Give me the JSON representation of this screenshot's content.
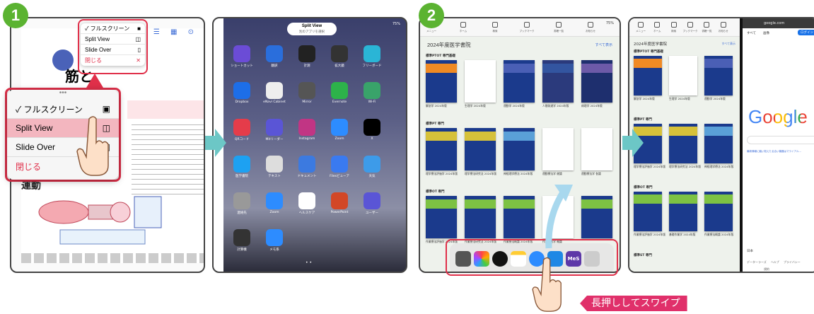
{
  "steps": [
    "1",
    "2"
  ],
  "panel1": {
    "menu_small": {
      "items": [
        {
          "label": "✓ フルスクリーン",
          "icon": "■"
        },
        {
          "label": "Split View",
          "icon": "◫"
        },
        {
          "label": "Slide Over",
          "icon": "▯"
        },
        {
          "label": "閉じる",
          "icon": "✕"
        }
      ]
    },
    "menu_big": {
      "items": [
        {
          "label": "✓ フルスクリーン",
          "icon": "▣"
        },
        {
          "label": "Split View",
          "icon": "◫"
        },
        {
          "label": "Slide Over",
          "icon": "▯"
        },
        {
          "label": "閉じる",
          "icon": ""
        }
      ]
    },
    "page_heading": "筋と",
    "heading_box": "運動"
  },
  "panel2": {
    "pill_title": "Split View",
    "pill_sub": "別のアプリを選択",
    "status_batt": "75%",
    "apps": [
      [
        "ショートカット",
        "翻訳",
        "計測",
        "拡大鏡",
        "フリーボード"
      ],
      [
        "Dropbox",
        "eNavi Cabinet",
        "Mirror",
        "Evernote",
        "Wi-Fi"
      ],
      [
        "QRコード",
        "Mitリーダー",
        "Instagram",
        "Zoom",
        "X"
      ],
      [
        "医学書院",
        "テキスト",
        "ドキュメント",
        "Filesビューア",
        "天気"
      ],
      [
        "連絡先",
        "Zoom",
        "ヘルスケア",
        "PowerPoint",
        "ユーザー"
      ],
      [
        "計算機",
        "メモ系",
        "",
        "",
        ""
      ]
    ],
    "app_colors": [
      [
        "#6b4cd6",
        "#2a6edc",
        "#222",
        "#333",
        "#2ab5d6"
      ],
      [
        "#1d6ee8",
        "#eee",
        "#555",
        "#2db24a",
        "#39a36a"
      ],
      [
        "#e53c4a",
        "#5a55d6",
        "#c13584",
        "#2d8cff",
        "#000"
      ],
      [
        "#1da1f2",
        "#ddd",
        "#3c7ae0",
        "#3a7af0",
        "#3d9be9"
      ],
      [
        "#999",
        "#2d8cff",
        "#fff",
        "#d24726",
        "#5a55d6"
      ],
      [
        "#333",
        "#2d8cff",
        "",
        "",
        ""
      ]
    ]
  },
  "panel3": {
    "status_batt": "75%",
    "toolbar": [
      "メニュー",
      "ホーム",
      "検索",
      "ブックマーク",
      "書籍一覧",
      "お知らせ"
    ],
    "title": "2024年度医学書院",
    "see_all": "すべて表示",
    "sections": [
      {
        "name": "標準PTOT 専門基礎",
        "books": [
          {
            "label": "解剖学 2024年版",
            "color": "#1b3a8c",
            "band": "#f08a24"
          },
          {
            "label": "生理学 2024年版",
            "color": "#ffffff",
            "band": "#ffffff"
          },
          {
            "label": "運動学 2024年版",
            "color": "#1b3a8c",
            "band": "#4a5fb5"
          },
          {
            "label": "人間発達学 2024年版",
            "color": "#2b3a7c",
            "band": "#3355a0"
          },
          {
            "label": "病理学 2024年版",
            "color": "#1e2f6e",
            "band": "#6d5aa8"
          }
        ]
      },
      {
        "name": "標準PT 専門",
        "books": [
          {
            "label": "理学療法評価学 2024年版",
            "color": "#1b3a8c",
            "band": "#d6c13a"
          },
          {
            "label": "理学療法研究法 2024年版",
            "color": "#1b3a8c",
            "band": "#d6c13a"
          },
          {
            "label": "神経理学療法 2024年版",
            "color": "#1b3a8c",
            "band": "#5aa0d8"
          },
          {
            "label": "運動療法学 総論",
            "color": "#ffffff",
            "band": "#ffffff"
          },
          {
            "label": "運動療法学 各論",
            "color": "#ffffff",
            "band": "#ffffff"
          }
        ]
      },
      {
        "name": "標準OT 専門",
        "books": [
          {
            "label": "作業療法評価学 2024年版",
            "color": "#1b3a8c",
            "band": "#7dc243"
          },
          {
            "label": "作業療法研究法 2024年版",
            "color": "#1b3a8c",
            "band": "#7dc243"
          },
          {
            "label": "作業療法概論 2024年版",
            "color": "#1b3a8c",
            "band": "#7dc243"
          },
          {
            "label": "作業療法学 概論",
            "color": "#ffffff",
            "band": "#ffffff"
          },
          {
            "label": "",
            "color": "#1b3a8c",
            "band": "#7dc243"
          }
        ]
      }
    ],
    "dock_badge": "MeS",
    "callout": "長押ししてスワイプ"
  },
  "panel4": {
    "left": {
      "toolbar": [
        "メニュー",
        "ホーム",
        "検索",
        "ブックマーク",
        "書籍一覧",
        "お知らせ"
      ],
      "title": "2024年度医学書院",
      "see_all": "すべて表示",
      "sections": [
        {
          "name": "標準PTOT 専門基礎",
          "books": [
            {
              "label": "解剖学 2024年版",
              "color": "#1b3a8c",
              "band": "#f08a24"
            },
            {
              "label": "生理学 2024年版",
              "color": "#ffffff",
              "band": "#ffffff"
            },
            {
              "label": "運動学 2024年版",
              "color": "#1b3a8c",
              "band": "#4a5fb5"
            }
          ]
        },
        {
          "name": "標準PT 専門",
          "books": [
            {
              "label": "理学療法評価学 2024年版",
              "color": "#1b3a8c",
              "band": "#d6c13a"
            },
            {
              "label": "理学療法研究法 2024年版",
              "color": "#1b3a8c",
              "band": "#d6c13a"
            },
            {
              "label": "神経理学療法 2024年版",
              "color": "#1b3a8c",
              "band": "#5aa0d8"
            }
          ]
        },
        {
          "name": "標準OT 専門",
          "books": [
            {
              "label": "作業療法評価学 2024年版",
              "color": "#1b3a8c",
              "band": "#7dc243"
            },
            {
              "label": "基礎作業学 2024年版",
              "color": "#1b3a8c",
              "band": "#7dc243"
            },
            {
              "label": "作業療法概論 2024年版",
              "color": "#1b3a8c",
              "band": "#7dc243"
            }
          ]
        },
        {
          "name": "標準ST 専門",
          "books": []
        }
      ]
    },
    "right": {
      "url": "google.com",
      "tabs": [
        "すべて",
        "画像",
        "ログイン"
      ],
      "logo": "Google",
      "hint": "最新情報に触い知えたる合い機器はマライアル...",
      "footer_country": "日本",
      "footer_links": [
        "データーラーズ",
        "ヘルプ",
        "プライバシー"
      ],
      "footer_link2": "規約"
    }
  }
}
